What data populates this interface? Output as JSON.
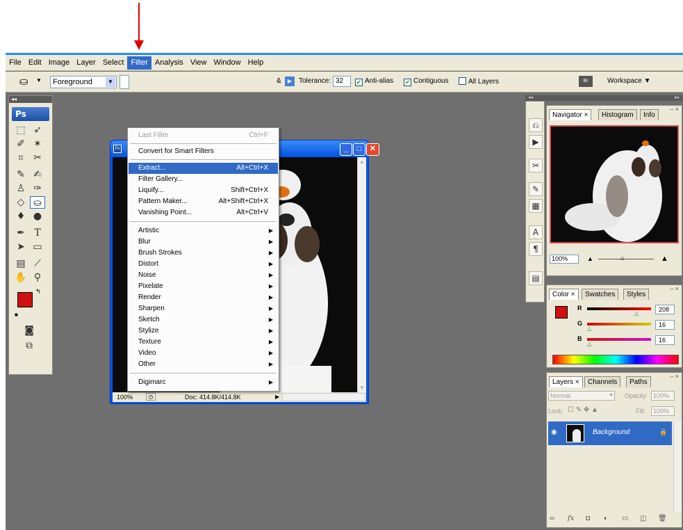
{
  "menubar": [
    "File",
    "Edit",
    "Image",
    "Layer",
    "Select",
    "Filter",
    "Analysis",
    "View",
    "Window",
    "Help"
  ],
  "options": {
    "fill_source": "Foreground",
    "tolerance_label": "Tolerance:",
    "tolerance_value": "32",
    "anti_alias": "Anti-alias",
    "contiguous": "Contiguous",
    "all_layers": "All Layers",
    "workspace": "Workspace ▼"
  },
  "toolbox": {
    "logo": "Ps"
  },
  "filter_menu": {
    "last_filter": "Last Filter",
    "last_filter_shortcut": "Ctrl+F",
    "convert": "Convert for Smart Filters",
    "items": [
      {
        "label": "Extract...",
        "shortcut": "Alt+Ctrl+X"
      },
      {
        "label": "Filter Gallery...",
        "shortcut": ""
      },
      {
        "label": "Liquify...",
        "shortcut": "Shift+Ctrl+X"
      },
      {
        "label": "Pattern Maker...",
        "shortcut": "Alt+Shift+Ctrl+X"
      },
      {
        "label": "Vanishing Point...",
        "shortcut": "Alt+Ctrl+V"
      }
    ],
    "submenus": [
      "Artistic",
      "Blur",
      "Brush Strokes",
      "Distort",
      "Noise",
      "Pixelate",
      "Render",
      "Sharpen",
      "Sketch",
      "Stylize",
      "Texture",
      "Video",
      "Other"
    ],
    "digimarc": "Digimarc"
  },
  "document": {
    "zoom": "100%",
    "doc_size": "Doc: 414.8K/414.8K"
  },
  "navigator": {
    "tabs": [
      "Navigator ×",
      "Histogram",
      "Info"
    ],
    "zoom": "100%"
  },
  "color_panel": {
    "tabs": [
      "Color ×",
      "Swatches",
      "Styles"
    ],
    "r_label": "R",
    "g_label": "G",
    "b_label": "B",
    "r_value": "208",
    "g_value": "16",
    "b_value": "16",
    "foreground_color": "#d01010"
  },
  "layers_panel": {
    "tabs": [
      "Layers ×",
      "Channels",
      "Paths"
    ],
    "blend_mode": "Normal",
    "opacity_label": "Opacity:",
    "opacity_value": "100%",
    "lock_label": "Lock:",
    "fill_label": "Fill:",
    "fill_value": "100%",
    "layer_name": "Background"
  },
  "colors": {
    "accent": "#316ac5",
    "highlight_arrow": "#e00000"
  }
}
